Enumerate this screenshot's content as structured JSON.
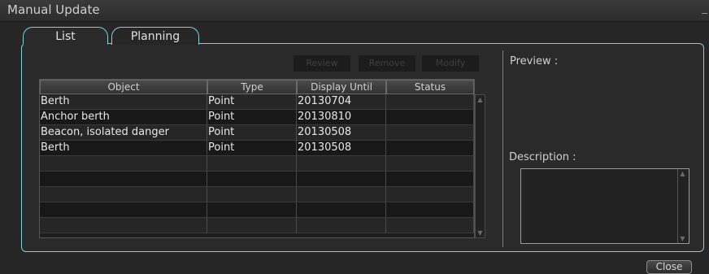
{
  "window": {
    "title": "Manual Update",
    "minimize_glyph": "_"
  },
  "tabs": [
    {
      "label": "List",
      "active": true
    },
    {
      "label": "Planning",
      "active": false
    }
  ],
  "toolbar": {
    "review_label": "Review",
    "remove_label": "Remove",
    "modify_label": "Modify"
  },
  "table": {
    "headers": [
      "Object",
      "Type",
      "Display Until",
      "Status"
    ],
    "rows": [
      [
        "Berth",
        "Point",
        "20130704",
        ""
      ],
      [
        "Anchor berth",
        "Point",
        "20130810",
        ""
      ],
      [
        "Beacon, isolated danger",
        "Point",
        "20130508",
        ""
      ],
      [
        "Berth",
        "Point",
        "20130508",
        ""
      ],
      [
        "",
        "",
        "",
        ""
      ],
      [
        "",
        "",
        "",
        ""
      ],
      [
        "",
        "",
        "",
        ""
      ],
      [
        "",
        "",
        "",
        ""
      ],
      [
        "",
        "",
        "",
        ""
      ]
    ]
  },
  "preview": {
    "label": "Preview :"
  },
  "description": {
    "label": "Description :",
    "value": ""
  },
  "footer": {
    "close_label": "Close"
  },
  "icons": {
    "scroll_up": "arrow-up-icon",
    "scroll_down": "arrow-down-icon"
  }
}
